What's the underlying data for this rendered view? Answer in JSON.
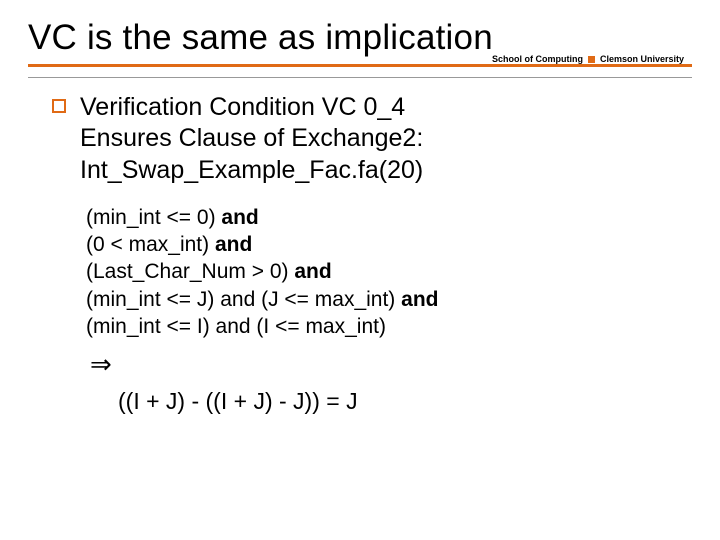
{
  "title": "VC is the same as implication",
  "subheader": {
    "left": "School of Computing",
    "right": "Clemson University"
  },
  "bullet": {
    "line1": "Verification Condition VC 0_4",
    "line2": "Ensures Clause of Exchange2:",
    "line3": "Int_Swap_Example_Fac.fa(20)"
  },
  "premises": {
    "p1a": "(min_int <= 0) ",
    "p1b": "and",
    "p2a": "(0 < max_int) ",
    "p2b": "and",
    "p3a": "(Last_Char_Num > 0) ",
    "p3b": "and",
    "p4a": "(min_int <= J) and (J <= max_int) ",
    "p4b": "and",
    "p5": "(min_int <= I) and (I <= max_int)"
  },
  "implies": "⇒",
  "conclusion": "((I + J) - ((I + J) - J)) = J"
}
